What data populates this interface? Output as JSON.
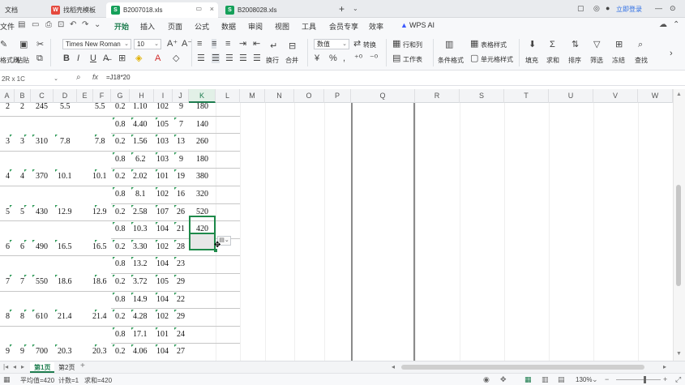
{
  "tabs": [
    {
      "label": "文档",
      "active": false
    },
    {
      "label": "找稻壳模板",
      "active": false,
      "icon": "wps-red-icon"
    },
    {
      "label": "B2007018.xls",
      "active": true,
      "icon": "sheet-green-icon"
    },
    {
      "label": "B2008028.xls",
      "active": false,
      "icon": "sheet-green-icon"
    }
  ],
  "login_label": "立即登录",
  "menu": [
    "文件",
    "开始",
    "插入",
    "页面",
    "公式",
    "数据",
    "审阅",
    "视图",
    "工具",
    "会员专享",
    "效率",
    "WPS AI"
  ],
  "menu_active": "开始",
  "ribbon": {
    "format_brush": "格式刷",
    "paste": "粘贴",
    "font_name": "Times New Roman",
    "font_size": "10",
    "wrap": "换行",
    "merge": "合并",
    "number_format": "数值",
    "convert": "转换",
    "rows_cols": "行和列",
    "worksheet": "工作表",
    "cond_format": "条件格式",
    "table_style": "表格样式",
    "cell_style": "单元格样式",
    "fill": "填充",
    "sum": "求和",
    "sort": "排序",
    "filter": "筛选",
    "freeze": "冻结",
    "find": "查找"
  },
  "formula_bar": {
    "name_box": "2R x 1C",
    "fx": "fx",
    "formula": "=J18*20"
  },
  "columns": [
    "A",
    "B",
    "C",
    "D",
    "E",
    "F",
    "G",
    "H",
    "I",
    "J",
    "K",
    "L",
    "M",
    "N",
    "O",
    "P",
    "Q",
    "R",
    "S",
    "T",
    "U",
    "V",
    "W"
  ],
  "selected_column": "K",
  "rows": [
    {
      "a": "2",
      "b": "2",
      "c": "245",
      "d": "5.5",
      "f": "5.5",
      "g": "0.2",
      "h": "1.10",
      "i": "102",
      "j": "9",
      "k": "180"
    },
    {
      "g": "0.8",
      "h": "4.40",
      "i": "105",
      "j": "7",
      "k": "140"
    },
    {
      "a": "3",
      "b": "3",
      "c": "310",
      "d": "7.8",
      "f": "7.8",
      "g": "0.2",
      "h": "1.56",
      "i": "103",
      "j": "13",
      "k": "260"
    },
    {
      "g": "0.8",
      "h": "6.2",
      "i": "103",
      "j": "9",
      "k": "180"
    },
    {
      "a": "4",
      "b": "4",
      "c": "370",
      "d": "10.1",
      "f": "10.1",
      "g": "0.2",
      "h": "2.02",
      "i": "101",
      "j": "19",
      "k": "380"
    },
    {
      "g": "0.8",
      "h": "8.1",
      "i": "102",
      "j": "16",
      "k": "320"
    },
    {
      "a": "5",
      "b": "5",
      "c": "430",
      "d": "12.9",
      "f": "12.9",
      "g": "0.2",
      "h": "2.58",
      "i": "107",
      "j": "26",
      "k": "520"
    },
    {
      "g": "0.8",
      "h": "10.3",
      "i": "104",
      "j": "21",
      "k": "420"
    },
    {
      "a": "6",
      "b": "6",
      "c": "490",
      "d": "16.5",
      "f": "16.5",
      "g": "0.2",
      "h": "3.30",
      "i": "102",
      "j": "28",
      "k": ""
    },
    {
      "g": "0.8",
      "h": "13.2",
      "i": "104",
      "j": "23",
      "k": ""
    },
    {
      "a": "7",
      "b": "7",
      "c": "550",
      "d": "18.6",
      "f": "18.6",
      "g": "0.2",
      "h": "3.72",
      "i": "105",
      "j": "29",
      "k": ""
    },
    {
      "g": "0.8",
      "h": "14.9",
      "i": "104",
      "j": "22",
      "k": ""
    },
    {
      "a": "8",
      "b": "8",
      "c": "610",
      "d": "21.4",
      "f": "21.4",
      "g": "0.2",
      "h": "4.28",
      "i": "102",
      "j": "29",
      "k": ""
    },
    {
      "g": "0.8",
      "h": "17.1",
      "i": "101",
      "j": "24",
      "k": ""
    },
    {
      "a": "9",
      "b": "9",
      "c": "700",
      "d": "20.3",
      "f": "20.3",
      "g": "0.2",
      "h": "4.06",
      "i": "104",
      "j": "27",
      "k": ""
    }
  ],
  "sheets": [
    {
      "label": "第1页",
      "active": true
    },
    {
      "label": "第2页",
      "active": false
    }
  ],
  "status": {
    "average": "平均值=420",
    "count": "计数=1",
    "sum": "求和=420",
    "zoom": "130%"
  }
}
